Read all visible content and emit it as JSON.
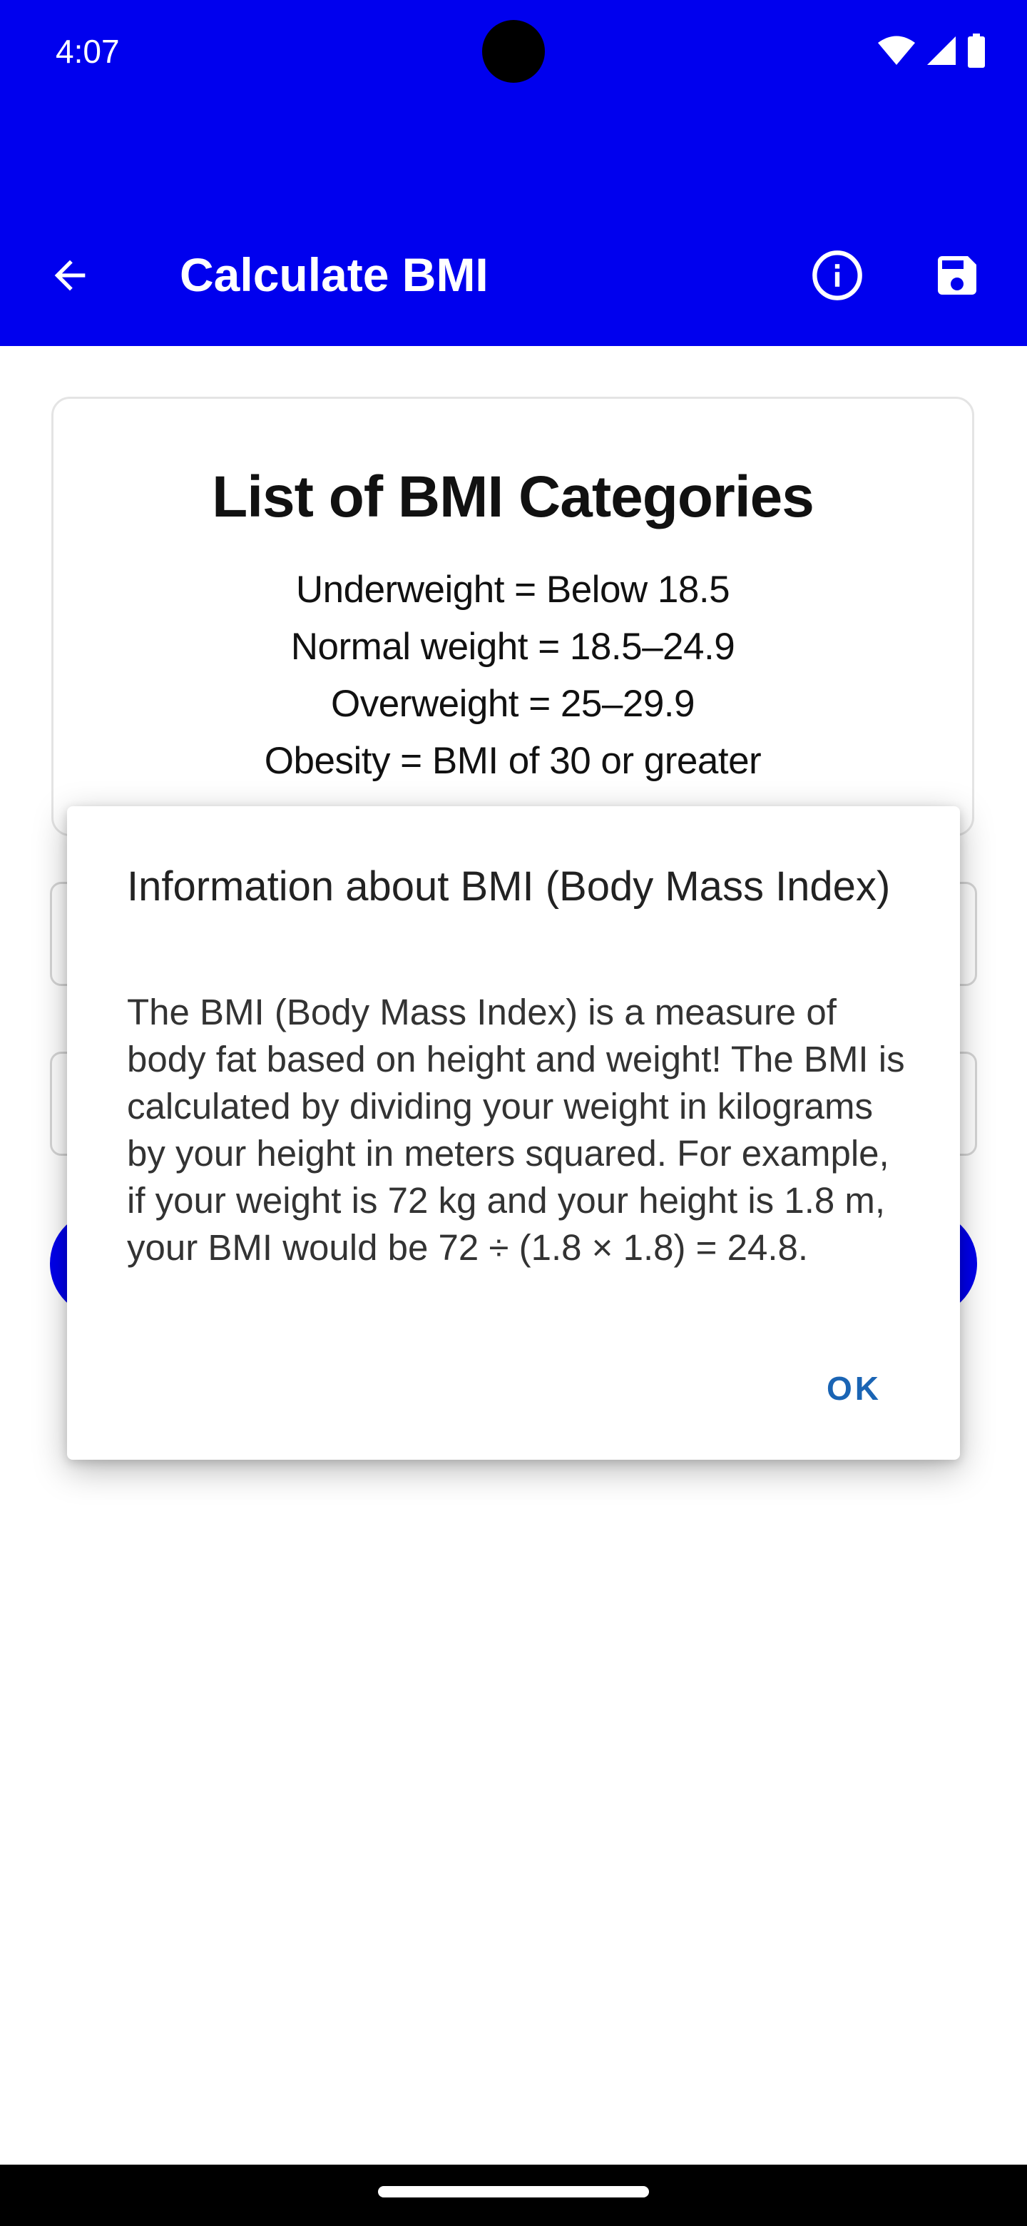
{
  "status_bar": {
    "time": "4:07",
    "icons": [
      "wifi-icon",
      "cellular-signal-icon",
      "battery-icon"
    ],
    "color": "#0000ee"
  },
  "app_bar": {
    "title": "Calculate BMI",
    "back_icon": "back-arrow-icon",
    "actions": [
      "info-icon",
      "save-icon"
    ],
    "color": "#0000ee"
  },
  "card": {
    "title": "List of BMI Categories",
    "lines": [
      "Underweight = Below 18.5",
      "Normal weight = 18.5–24.9",
      "Overweight = 25–29.9",
      "Obesity = BMI of 30 or greater"
    ]
  },
  "dialog": {
    "title": "Information about BMI (Body Mass Index)",
    "body": "The BMI (Body Mass Index) is a measure of body fat based on height and weight! The BMI is calculated by dividing your weight in kilograms by your height in meters squared. For example, if your weight is 72 kg and your height is 1.8 m, your BMI would be 72 ÷ (1.8 × 1.8) = 24.8.",
    "ok_label": "OK",
    "accent": "#1a64b4"
  }
}
